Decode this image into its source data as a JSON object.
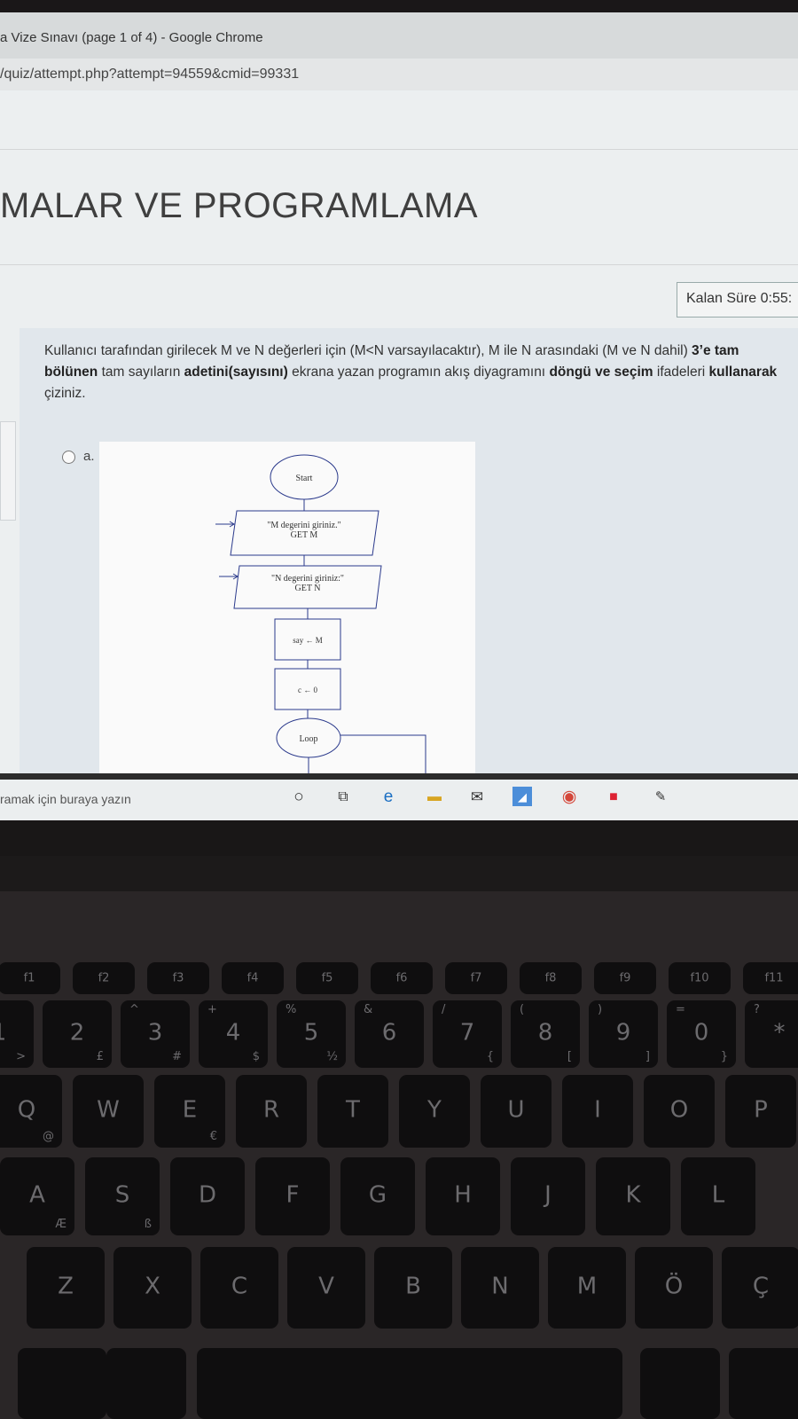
{
  "browser": {
    "window_title": "a Vize Sınavı (page 1 of 4) - Google Chrome",
    "url": "/quiz/attempt.php?attempt=94559&cmid=99331"
  },
  "page": {
    "course_title": "MALAR VE PROGRAMLAMA",
    "timer": "Kalan Süre 0:55:",
    "question": {
      "p1": "Kullanıcı tarafından girilecek M ve N değerleri için (M<N varsayılacaktır), M ile N arasındaki (M ve N dahil) ",
      "b1": "3’e tam bölünen",
      "p2": " tam sayıların ",
      "b2": "adetini(sayısını)",
      "p3": " ekrana yazan programın akış diyagramını ",
      "b3": "döngü ve seçim",
      "p4": " ifadeleri ",
      "b4": "kullanarak",
      "p5": " çiziniz."
    },
    "option_a": "a."
  },
  "flowchart": {
    "start": "Start",
    "io1_line1": "\"M degerini giriniz.\"",
    "io1_line2": "GET M",
    "io2_line1": "\"N degerini giriniz:\"",
    "io2_line2": "GET N",
    "proc1": "say ← M",
    "proc2": "c ← 0",
    "loop": "Loop"
  },
  "taskbar": {
    "search_text": "ramak için buraya yazın"
  },
  "keyboard": {
    "fn_row": [
      "f1",
      "f2",
      "f3",
      "f4",
      "f5",
      "f6",
      "f7",
      "f8",
      "f9",
      "f10",
      "f11"
    ],
    "num_row": [
      {
        "m": "1",
        "s": ">"
      },
      {
        "m": "2",
        "s": "£"
      },
      {
        "m": "3",
        "s": "#",
        "u": "^"
      },
      {
        "m": "4",
        "s": "$",
        "u": "+"
      },
      {
        "m": "5",
        "s": "½",
        "u": "%"
      },
      {
        "m": "6",
        "s": "",
        "u": "&"
      },
      {
        "m": "7",
        "s": "{",
        "u": "/"
      },
      {
        "m": "8",
        "s": "[",
        "u": "("
      },
      {
        "m": "9",
        "s": "]",
        "u": ")"
      },
      {
        "m": "0",
        "s": "}",
        "u": "="
      },
      {
        "m": "*",
        "s": "",
        "u": "?"
      }
    ],
    "q_row": [
      {
        "m": "Q",
        "s": "@"
      },
      {
        "m": "W",
        "s": ""
      },
      {
        "m": "E",
        "s": "€"
      },
      {
        "m": "R",
        "s": ""
      },
      {
        "m": "T",
        "s": ""
      },
      {
        "m": "Y",
        "s": ""
      },
      {
        "m": "U",
        "s": ""
      },
      {
        "m": "I",
        "s": ""
      },
      {
        "m": "O",
        "s": ""
      },
      {
        "m": "P",
        "s": ""
      }
    ],
    "a_row": [
      {
        "m": "A",
        "s": "Æ"
      },
      {
        "m": "S",
        "s": "ß"
      },
      {
        "m": "D",
        "s": ""
      },
      {
        "m": "F",
        "s": ""
      },
      {
        "m": "G",
        "s": ""
      },
      {
        "m": "H",
        "s": ""
      },
      {
        "m": "J",
        "s": ""
      },
      {
        "m": "K",
        "s": ""
      },
      {
        "m": "L",
        "s": ""
      }
    ],
    "z_row": [
      {
        "m": "Z",
        "s": ""
      },
      {
        "m": "X",
        "s": ""
      },
      {
        "m": "C",
        "s": ""
      },
      {
        "m": "V",
        "s": ""
      },
      {
        "m": "B",
        "s": ""
      },
      {
        "m": "N",
        "s": ""
      },
      {
        "m": "M",
        "s": ""
      },
      {
        "m": "Ö",
        "s": ""
      },
      {
        "m": "Ç",
        "s": ""
      }
    ]
  },
  "colors": {
    "page_bg": "#eceff0",
    "question_bg": "#e1e7ec",
    "flow_stroke": "#2b3a8c",
    "key_cap": "#0f0e0f",
    "deck": "#2a2627"
  }
}
